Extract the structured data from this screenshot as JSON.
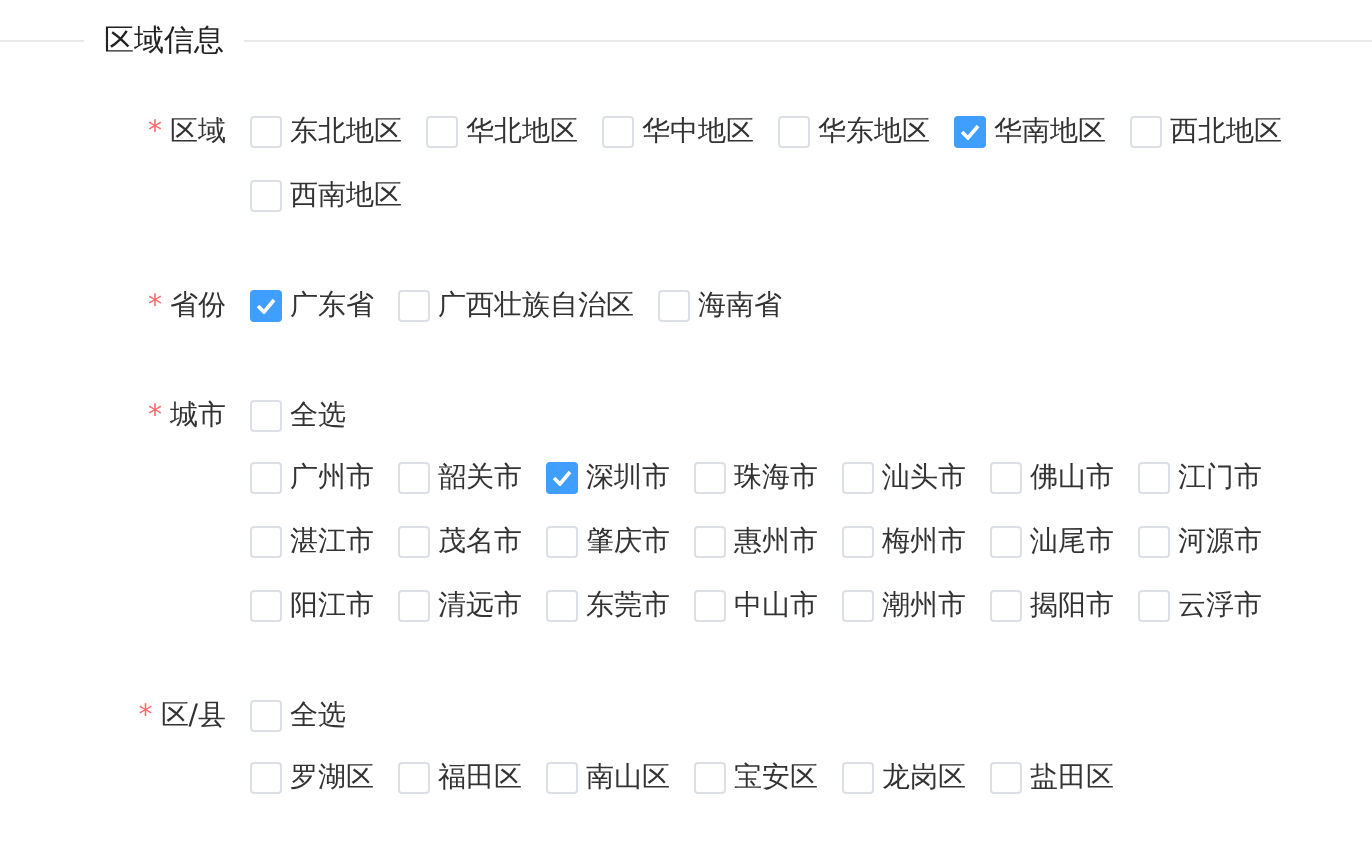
{
  "section": {
    "title": "区域信息"
  },
  "fields": [
    {
      "label": "区域",
      "required_mark": "*",
      "options": [
        {
          "label": "东北地区",
          "checked": false
        },
        {
          "label": "华北地区",
          "checked": false
        },
        {
          "label": "华中地区",
          "checked": false
        },
        {
          "label": "华东地区",
          "checked": false
        },
        {
          "label": "华南地区",
          "checked": true
        },
        {
          "label": "西北地区",
          "checked": false
        },
        {
          "label": "西南地区",
          "checked": false
        }
      ]
    },
    {
      "label": "省份",
      "required_mark": "*",
      "options": [
        {
          "label": "广东省",
          "checked": true
        },
        {
          "label": "广西壮族自治区",
          "checked": false
        },
        {
          "label": "海南省",
          "checked": false
        }
      ]
    },
    {
      "label": "城市",
      "required_mark": "*",
      "select_all": {
        "label": "全选",
        "checked": false
      },
      "options": [
        {
          "label": "广州市",
          "checked": false
        },
        {
          "label": "韶关市",
          "checked": false
        },
        {
          "label": "深圳市",
          "checked": true
        },
        {
          "label": "珠海市",
          "checked": false
        },
        {
          "label": "汕头市",
          "checked": false
        },
        {
          "label": "佛山市",
          "checked": false
        },
        {
          "label": "江门市",
          "checked": false
        },
        {
          "label": "湛江市",
          "checked": false
        },
        {
          "label": "茂名市",
          "checked": false
        },
        {
          "label": "肇庆市",
          "checked": false
        },
        {
          "label": "惠州市",
          "checked": false
        },
        {
          "label": "梅州市",
          "checked": false
        },
        {
          "label": "汕尾市",
          "checked": false
        },
        {
          "label": "河源市",
          "checked": false
        },
        {
          "label": "阳江市",
          "checked": false
        },
        {
          "label": "清远市",
          "checked": false
        },
        {
          "label": "东莞市",
          "checked": false
        },
        {
          "label": "中山市",
          "checked": false
        },
        {
          "label": "潮州市",
          "checked": false
        },
        {
          "label": "揭阳市",
          "checked": false
        },
        {
          "label": "云浮市",
          "checked": false
        }
      ]
    },
    {
      "label": "区/县",
      "required_mark": "*",
      "select_all": {
        "label": "全选",
        "checked": false
      },
      "options": [
        {
          "label": "罗湖区",
          "checked": false
        },
        {
          "label": "福田区",
          "checked": false
        },
        {
          "label": "南山区",
          "checked": false
        },
        {
          "label": "宝安区",
          "checked": false
        },
        {
          "label": "龙岗区",
          "checked": false
        },
        {
          "label": "盐田区",
          "checked": false
        }
      ]
    }
  ]
}
